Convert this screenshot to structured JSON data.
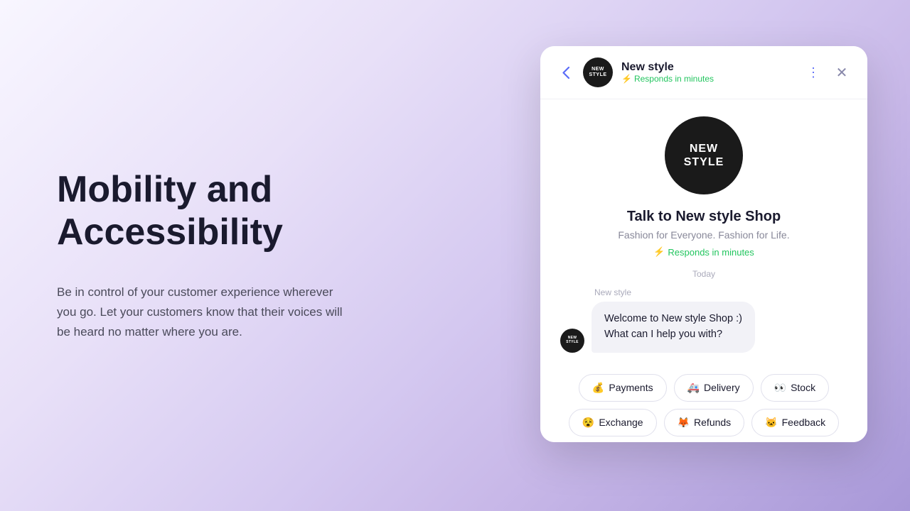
{
  "background": {
    "gradient": "from-purple-50 to-purple-300"
  },
  "left": {
    "title_line1": "Mobility and",
    "title_line2": "Accessibility",
    "description": "Be in control of your customer experience wherever you go. Let your customers know that their voices will be heard no matter where you are."
  },
  "chat": {
    "header": {
      "back_icon": "‹",
      "avatar_text_top": "NEW",
      "avatar_text_bottom": "STYLE",
      "name": "New style",
      "status_icon": "⚡",
      "status_text": "Responds in minutes",
      "more_icon": "⋮",
      "close_icon": "✕"
    },
    "body": {
      "shop_logo_top": "NEW",
      "shop_logo_bottom": "STYLE",
      "shop_title": "Talk to New style Shop",
      "shop_subtitle": "Fashion for Everyone. Fashion for Life.",
      "response_icon": "⚡",
      "response_text": "Responds in minutes",
      "today_label": "Today",
      "message_sender": "New style",
      "welcome_message": "Welcome to New style Shop :)\nWhat can I help you with?"
    },
    "quick_replies": [
      {
        "emoji": "💰",
        "label": "Payments"
      },
      {
        "emoji": "🚑",
        "label": "Delivery"
      },
      {
        "emoji": "👀",
        "label": "Stock"
      },
      {
        "emoji": "😵",
        "label": "Exchange"
      },
      {
        "emoji": "🦊",
        "label": "Refunds"
      },
      {
        "emoji": "🐱",
        "label": "Feedback"
      }
    ]
  }
}
